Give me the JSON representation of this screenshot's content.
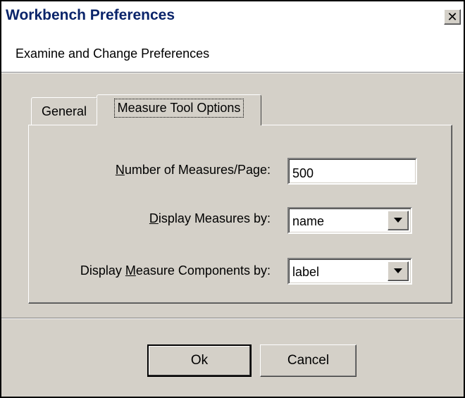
{
  "window": {
    "title": "Workbench Preferences",
    "close_glyph": "✕"
  },
  "header": {
    "subtitle": "Examine and Change Preferences"
  },
  "tabs": [
    {
      "label": "General",
      "active": false
    },
    {
      "label": "Measure Tool Options",
      "active": true
    }
  ],
  "form": {
    "measures_per_page": {
      "label_pre": "",
      "label_key": "N",
      "label_post": "umber of Measures/Page:",
      "value": "500"
    },
    "display_measures_by": {
      "label_pre": "",
      "label_key": "D",
      "label_post": "isplay Measures by:",
      "value": "name"
    },
    "display_components_by": {
      "label_pre": "Display ",
      "label_key": "M",
      "label_post": "easure Components by:",
      "value": "label"
    }
  },
  "buttons": {
    "ok": "Ok",
    "cancel": "Cancel"
  },
  "icons": {
    "close": "close-icon",
    "dropdown": "chevron-down-icon"
  },
  "colors": {
    "title_text": "#0a246a",
    "dialog_bg": "#d4d0c8"
  }
}
